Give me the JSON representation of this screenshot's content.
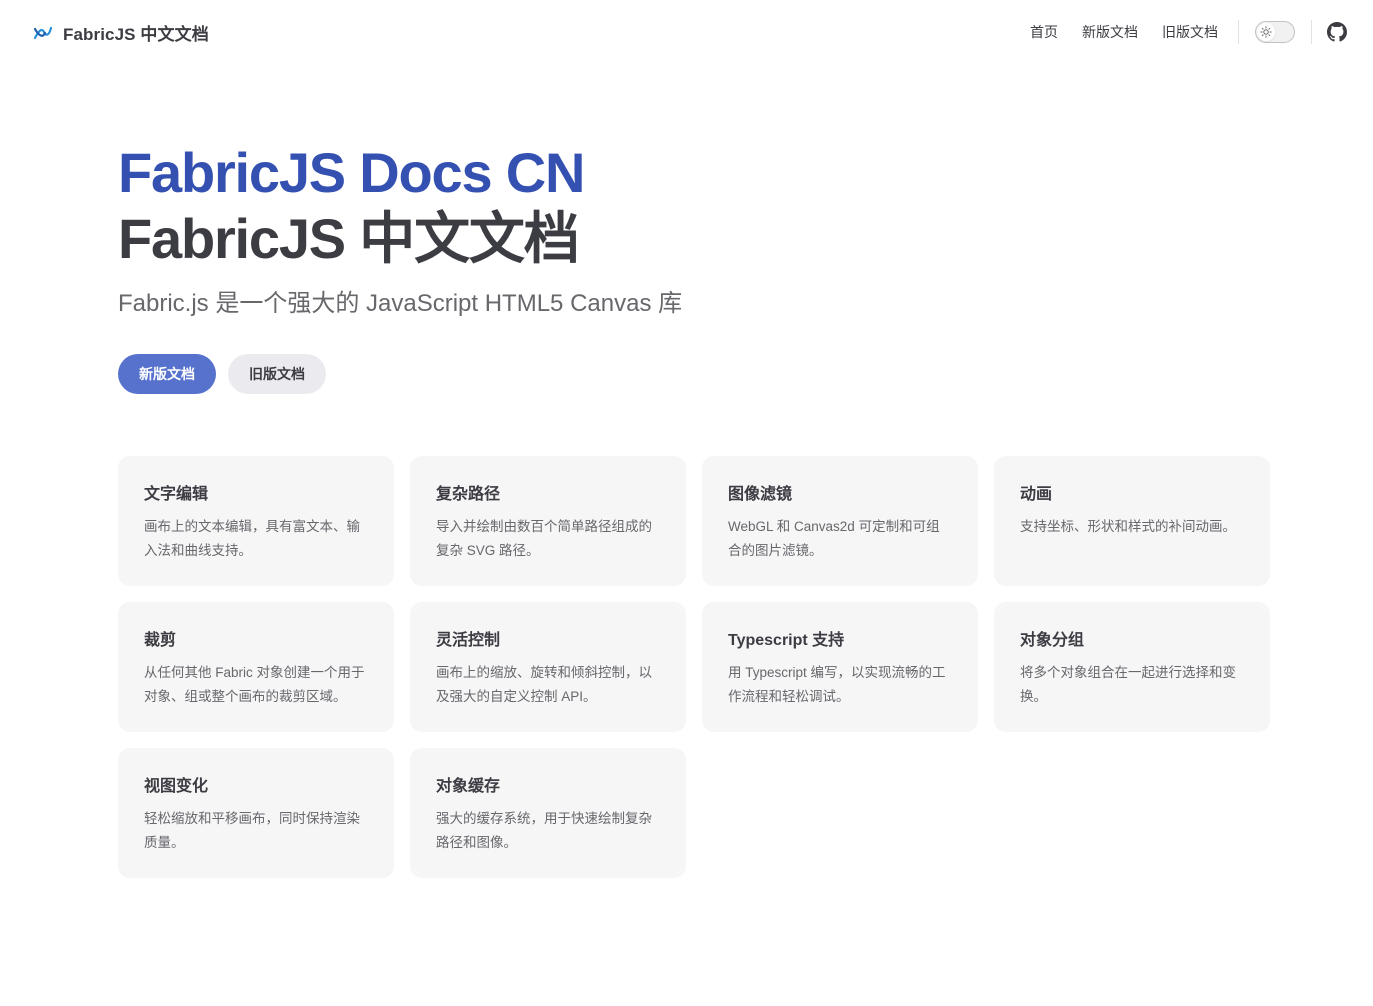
{
  "nav": {
    "brand": "FabricJS 中文文档",
    "links": [
      "首页",
      "新版文档",
      "旧版文档"
    ]
  },
  "hero": {
    "name": "FabricJS Docs CN",
    "text": "FabricJS 中文文档",
    "tagline": "Fabric.js 是一个强大的 JavaScript HTML5 Canvas 库",
    "actions": [
      {
        "label": "新版文档",
        "theme": "brand"
      },
      {
        "label": "旧版文档",
        "theme": "alt"
      }
    ]
  },
  "features": [
    {
      "title": "文字编辑",
      "details": "画布上的文本编辑，具有富文本、输入法和曲线支持。"
    },
    {
      "title": "复杂路径",
      "details": "导入并绘制由数百个简单路径组成的复杂 SVG 路径。"
    },
    {
      "title": "图像滤镜",
      "details": "WebGL 和 Canvas2d 可定制和可组合的图片滤镜。"
    },
    {
      "title": "动画",
      "details": "支持坐标、形状和样式的补间动画。"
    },
    {
      "title": "裁剪",
      "details": "从任何其他 Fabric 对象创建一个用于对象、组或整个画布的裁剪区域。"
    },
    {
      "title": "灵活控制",
      "details": "画布上的缩放、旋转和倾斜控制，以及强大的自定义控制 API。"
    },
    {
      "title": "Typescript 支持",
      "details": "用 Typescript 编写，以实现流畅的工作流程和轻松调试。"
    },
    {
      "title": "对象分组",
      "details": "将多个对象组合在一起进行选择和变换。"
    },
    {
      "title": "视图变化",
      "details": "轻松缩放和平移画布，同时保持渲染质量。"
    },
    {
      "title": "对象缓存",
      "details": "强大的缓存系统，用于快速绘制复杂路径和图像。"
    }
  ],
  "colors": {
    "brand": "#3451b2",
    "button_brand": "#5672cd",
    "text": "#3c3c43",
    "muted": "#67676c",
    "card_bg": "#f6f6f7"
  },
  "icons": {
    "logo": "fabric-logo-icon",
    "theme": "sun-icon",
    "repo": "github-icon"
  }
}
